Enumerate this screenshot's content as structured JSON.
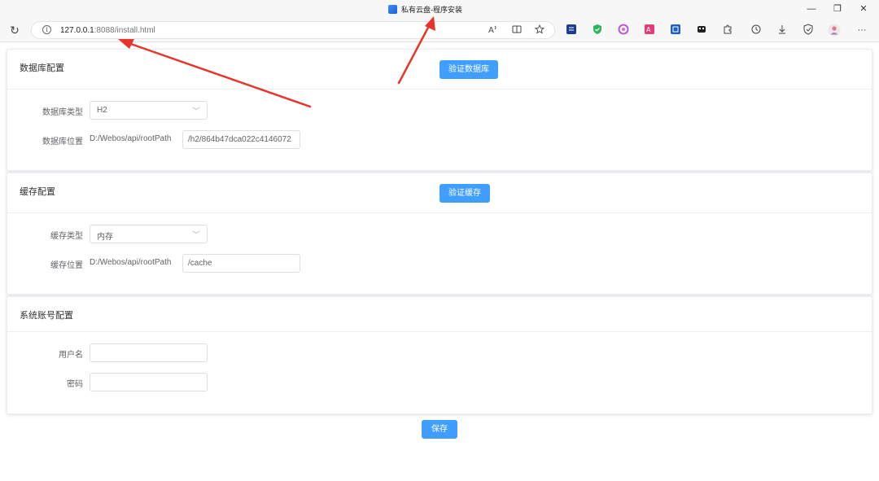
{
  "window": {
    "title": "私有云盘-程序安装",
    "minimize_glyph": "—",
    "restore_glyph": "❐",
    "close_glyph": "✕"
  },
  "browser": {
    "url_host": "127.0.0.1",
    "url_rest": ":8088/install.html",
    "reload_glyph": "↻",
    "info_glyph": "i",
    "more_glyph": "···"
  },
  "database": {
    "title": "数据库配置",
    "verify_button": "验证数据库",
    "type_label": "数据库类型",
    "type_value": "H2",
    "location_label": "数据库位置",
    "location_prefix": "D:/Webos/api/rootPath",
    "location_value": "/h2/864b47dca022c4146072"
  },
  "cache": {
    "title": "缓存配置",
    "verify_button": "验证缓存",
    "type_label": "缓存类型",
    "type_value": "内存",
    "location_label": "缓存位置",
    "location_prefix": "D:/Webos/api/rootPath",
    "location_value": "/cache"
  },
  "account": {
    "title": "系统账号配置",
    "username_label": "用户名",
    "username_value": "",
    "password_label": "密码",
    "password_value": ""
  },
  "save_button": "保存",
  "colors": {
    "primary": "#409eff",
    "annotation_arrow": "#e8352b"
  }
}
